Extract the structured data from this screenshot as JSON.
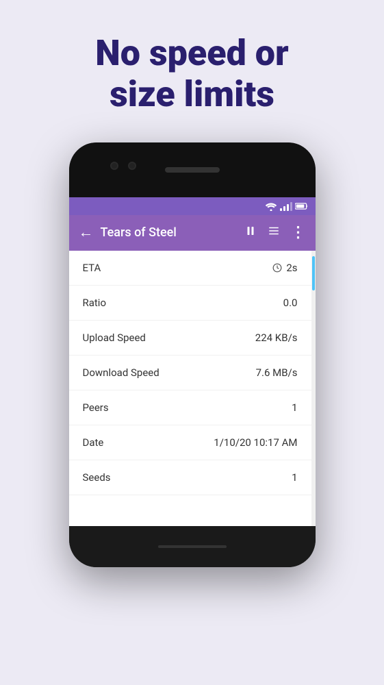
{
  "headline": {
    "line1": "No speed or",
    "line2": "size limits"
  },
  "background_color": "#eceaf4",
  "phone": {
    "toolbar": {
      "back_icon": "←",
      "title": "Tears of Steel",
      "pause_icon": "⏸",
      "list_icon": "☰",
      "more_icon": "⋮"
    },
    "info_rows": [
      {
        "label": "ETA",
        "value": "2s",
        "has_clock": true
      },
      {
        "label": "Ratio",
        "value": "0.0",
        "has_clock": false
      },
      {
        "label": "Upload Speed",
        "value": "224 KB/s",
        "has_clock": false
      },
      {
        "label": "Download Speed",
        "value": "7.6 MB/s",
        "has_clock": false
      },
      {
        "label": "Peers",
        "value": "1",
        "has_clock": false
      },
      {
        "label": "Date",
        "value": "1/10/20 10:17 AM",
        "has_clock": false
      },
      {
        "label": "Seeds",
        "value": "1",
        "has_clock": false
      }
    ]
  }
}
